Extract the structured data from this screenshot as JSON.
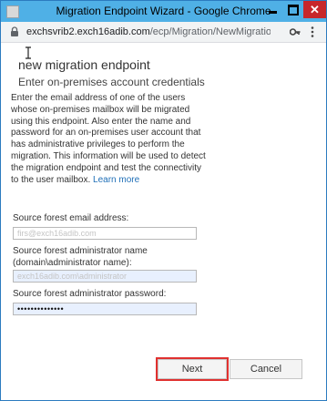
{
  "window": {
    "title": "Migration Endpoint Wizard - Google Chrome"
  },
  "addressbar": {
    "host": "exchsvrib2.exch16adib.com",
    "path": "/ecp/Migration/NewMigrationEndpoi..."
  },
  "page": {
    "title": "new migration endpoint",
    "subtitle": "Enter on-premises account credentials",
    "intro": "Enter the email address of one of the users whose on-premises mailbox will be migrated using this endpoint. Also enter the name and password for an on-premises user account that has administrative privileges to perform the migration. This information will be used to detect the migration endpoint and test the connectivity to the user mailbox.",
    "learn_more": "Learn more"
  },
  "form": {
    "email_label": "Source forest email address:",
    "email_value": "firs@exch16adib.com",
    "admin_name_label": "Source forest administrator name (domain\\administrator name):",
    "admin_name_value": "exch16adib.com\\administrator",
    "admin_password_label": "Source forest administrator password:",
    "admin_password_value": "••••••••••••••"
  },
  "buttons": {
    "next": "Next",
    "cancel": "Cancel"
  },
  "colors": {
    "titlebar": "#4fb0e6",
    "close": "#c7272b",
    "link": "#1f6fb7",
    "highlight": "#e0312f"
  }
}
